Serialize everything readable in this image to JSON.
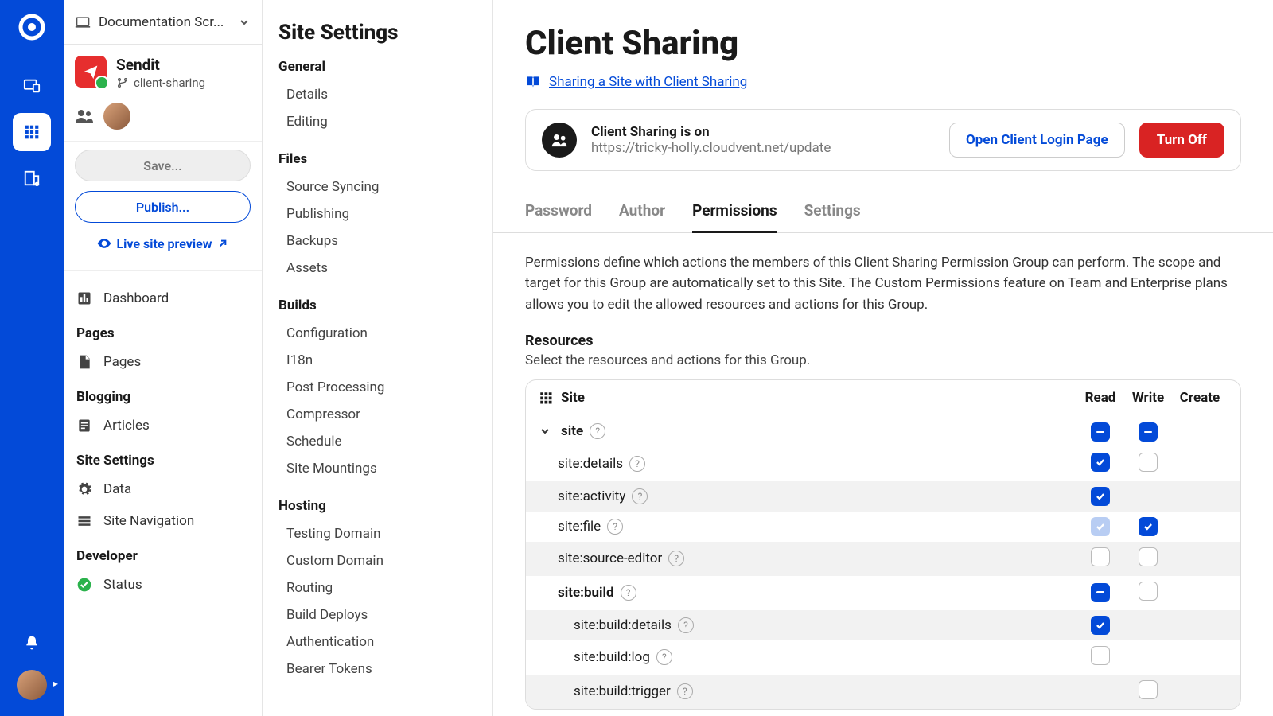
{
  "rail": {
    "items": [
      "devices",
      "grid",
      "settings"
    ]
  },
  "project_selector": {
    "label": "Documentation Scr..."
  },
  "site": {
    "name": "Sendit",
    "context": "client-sharing"
  },
  "buttons": {
    "save": "Save...",
    "publish": "Publish...",
    "preview": "Live site preview"
  },
  "nav": {
    "dashboard": "Dashboard",
    "pages_head": "Pages",
    "pages": "Pages",
    "blogging_head": "Blogging",
    "articles": "Articles",
    "settings_head": "Site Settings",
    "data": "Data",
    "sitenav": "Site Navigation",
    "dev_head": "Developer",
    "status": "Status"
  },
  "settings_panel": {
    "title": "Site Settings",
    "groups": [
      {
        "head": "General",
        "items": [
          "Details",
          "Editing"
        ]
      },
      {
        "head": "Files",
        "items": [
          "Source Syncing",
          "Publishing",
          "Backups",
          "Assets"
        ]
      },
      {
        "head": "Builds",
        "items": [
          "Configuration",
          "I18n",
          "Post Processing",
          "Compressor",
          "Schedule",
          "Site Mountings"
        ]
      },
      {
        "head": "Hosting",
        "items": [
          "Testing Domain",
          "Custom Domain",
          "Routing",
          "Build Deploys",
          "Authentication",
          "Bearer Tokens"
        ]
      }
    ]
  },
  "page": {
    "title": "Client Sharing",
    "doc_link": "Sharing a Site with Client Sharing",
    "status_title": "Client Sharing is on",
    "status_url": "https://tricky-holly.cloudvent.net/update",
    "open_btn": "Open Client Login Page",
    "off_btn": "Turn Off",
    "tabs": [
      "Password",
      "Author",
      "Permissions",
      "Settings"
    ],
    "active_tab": 2,
    "perm_desc": "Permissions define which actions the members of this Client Sharing Permission Group can perform. The scope and target for this Group are automatically set to this Site. The Custom Permissions feature on Team and Enterprise plans allows you to edit the allowed resources and actions for this Group.",
    "resources_head": "Resources",
    "resources_sub": "Select the resources and actions for this Group.",
    "table": {
      "title": "Site",
      "cols": [
        "Read",
        "Write",
        "Create"
      ],
      "rows": [
        {
          "label": "site",
          "level": 0,
          "expand": true,
          "read": "partial",
          "write": "partial",
          "create": null
        },
        {
          "label": "site:details",
          "level": 1,
          "read": "on",
          "write": "off",
          "create": null,
          "hide_create": true
        },
        {
          "label": "site:activity",
          "level": 1,
          "read": "on",
          "write": null,
          "create": null,
          "hide_create": true,
          "alt": true
        },
        {
          "label": "site:file",
          "level": 1,
          "read": "dim",
          "write": "on",
          "create": null,
          "hide_create": true
        },
        {
          "label": "site:source-editor",
          "level": 1,
          "read": "off",
          "write": "off",
          "create": null,
          "hide_create": true,
          "alt": true
        },
        {
          "label": "site:build",
          "level": 2,
          "read": "partial",
          "write": "off",
          "create": null,
          "hide_create": true
        },
        {
          "label": "site:build:details",
          "level": 3,
          "read": "on",
          "write": null,
          "create": null,
          "hide_create": true,
          "alt": true
        },
        {
          "label": "site:build:log",
          "level": 3,
          "read": "off",
          "write": null,
          "create": null,
          "hide_create": true
        },
        {
          "label": "site:build:trigger",
          "level": 3,
          "read": null,
          "write": "off",
          "create": null,
          "hide_create": true,
          "alt": true
        }
      ]
    }
  }
}
